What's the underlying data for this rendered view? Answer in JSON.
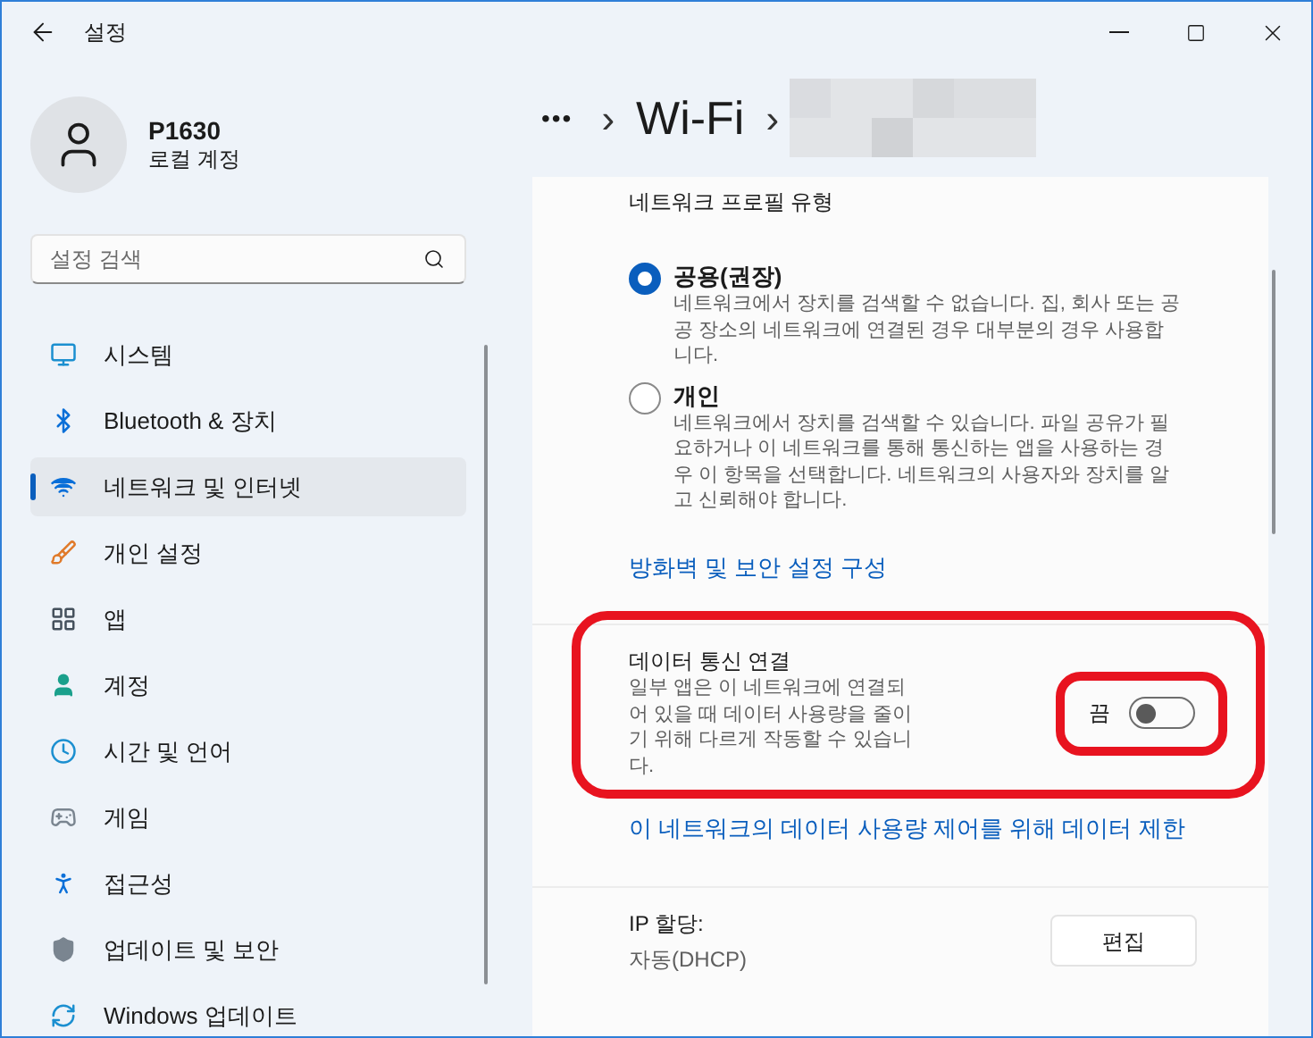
{
  "window": {
    "title": "설정"
  },
  "profile": {
    "name": "P1630",
    "account_type": "로컬 계정"
  },
  "search": {
    "placeholder": "설정 검색"
  },
  "sidebar": {
    "items": [
      {
        "label": "시스템",
        "selected": false
      },
      {
        "label": "Bluetooth & 장치",
        "selected": false
      },
      {
        "label": "네트워크 및 인터넷",
        "selected": true
      },
      {
        "label": "개인 설정",
        "selected": false
      },
      {
        "label": "앱",
        "selected": false
      },
      {
        "label": "계정",
        "selected": false
      },
      {
        "label": "시간 및 언어",
        "selected": false
      },
      {
        "label": "게임",
        "selected": false
      },
      {
        "label": "접근성",
        "selected": false
      },
      {
        "label": "업데이트 및 보안",
        "selected": false
      },
      {
        "label": "Windows 업데이트",
        "selected": false
      }
    ]
  },
  "breadcrumb": {
    "more": "•••",
    "separator": "›",
    "current": "Wi-Fi"
  },
  "profile_type": {
    "title": "네트워크 프로필 유형",
    "options": [
      {
        "label": "공용(권장)",
        "description": "네트워크에서 장치를 검색할 수 없습니다. 집, 회사 또는 공공 장소의 네트워크에 연결된 경우 대부분의 경우 사용합니다.",
        "selected": true
      },
      {
        "label": "개인",
        "description": "네트워크에서 장치를 검색할 수 있습니다. 파일 공유가 필요하거나 이 네트워크를 통해 통신하는 앱을 사용하는 경우 이 항목을 선택합니다. 네트워크의 사용자와 장치를 알고 신뢰해야 합니다.",
        "selected": false
      }
    ],
    "link": "방화벽 및 보안 설정 구성"
  },
  "metered": {
    "title": "데이터 통신 연결",
    "description": "일부 앱은 이 네트워크에 연결되어 있을 때 데이터 사용량을 줄이기 위해 다르게 작동할 수 있습니다.",
    "toggle_label": "끔",
    "on": false,
    "link": "이 네트워크의 데이터 사용량 제어를 위해 데이터 제한"
  },
  "ip": {
    "title": "IP 할당:",
    "value": "자동(DHCP)",
    "button": "편집"
  }
}
